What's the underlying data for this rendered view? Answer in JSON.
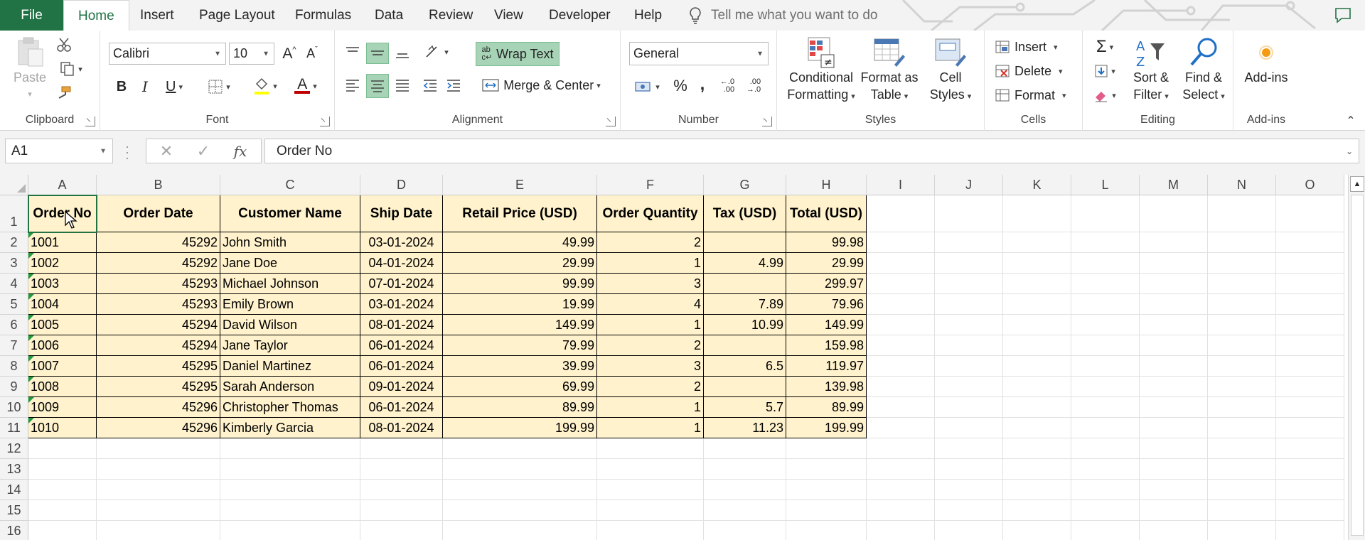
{
  "tabs": {
    "file": "File",
    "items": [
      "Home",
      "Insert",
      "Page Layout",
      "Formulas",
      "Data",
      "Review",
      "View",
      "Developer",
      "Help"
    ],
    "active": "Home",
    "tell_me": "Tell me what you want to do"
  },
  "ribbon": {
    "clipboard": {
      "label": "Clipboard",
      "paste": "Paste"
    },
    "font": {
      "label": "Font",
      "name": "Calibri",
      "size": "10",
      "bold": "B",
      "italic": "I",
      "underline": "U",
      "grow": "A",
      "shrink": "A",
      "fill_letter": "A"
    },
    "alignment": {
      "label": "Alignment",
      "wrap_text": "Wrap Text",
      "merge_center": "Merge & Center"
    },
    "number": {
      "label": "Number",
      "format": "General",
      "percent": "%",
      "comma": ","
    },
    "styles": {
      "label": "Styles",
      "conditional": [
        "Conditional",
        "Formatting"
      ],
      "format_table": [
        "Format as",
        "Table"
      ],
      "cell_styles": [
        "Cell",
        "Styles"
      ]
    },
    "cells": {
      "label": "Cells",
      "insert": "Insert",
      "delete": "Delete",
      "format": "Format"
    },
    "editing": {
      "label": "Editing",
      "sort": [
        "Sort &",
        "Filter"
      ],
      "find": [
        "Find &",
        "Select"
      ]
    },
    "addins": {
      "label": "Add-ins",
      "addins": "Add-ins"
    }
  },
  "formula_bar": {
    "name_box": "A1",
    "fx": "fx",
    "value": "Order No"
  },
  "sheet": {
    "columns": [
      "A",
      "B",
      "C",
      "D",
      "E",
      "F",
      "G",
      "H",
      "I",
      "J",
      "K",
      "L",
      "M",
      "N",
      "O"
    ],
    "rows": [
      "1",
      "2",
      "3",
      "4",
      "5",
      "6",
      "7",
      "8",
      "9",
      "10",
      "11",
      "12",
      "13",
      "14",
      "15",
      "16"
    ],
    "headers": [
      "Order No",
      "Order Date",
      "Customer Name",
      "Ship Date",
      "Retail Price (USD)",
      "Order Quantity",
      "Tax (USD)",
      "Total (USD)"
    ],
    "records": [
      [
        "1001",
        "45292",
        "John Smith",
        "03-01-2024",
        "49.99",
        "2",
        "",
        "99.98"
      ],
      [
        "1002",
        "45292",
        "Jane Doe",
        "04-01-2024",
        "29.99",
        "1",
        "4.99",
        "29.99"
      ],
      [
        "1003",
        "45293",
        "Michael Johnson",
        "07-01-2024",
        "99.99",
        "3",
        "",
        "299.97"
      ],
      [
        "1004",
        "45293",
        "Emily Brown",
        "03-01-2024",
        "19.99",
        "4",
        "7.89",
        "79.96"
      ],
      [
        "1005",
        "45294",
        "David Wilson",
        "08-01-2024",
        "149.99",
        "1",
        "10.99",
        "149.99"
      ],
      [
        "1006",
        "45294",
        "Jane Taylor",
        "06-01-2024",
        "79.99",
        "2",
        "",
        "159.98"
      ],
      [
        "1007",
        "45295",
        "Daniel Martinez",
        "06-01-2024",
        "39.99",
        "3",
        "6.5",
        "119.97"
      ],
      [
        "1008",
        "45295",
        "Sarah Anderson",
        "09-01-2024",
        "69.99",
        "2",
        "",
        "139.98"
      ],
      [
        "1009",
        "45296",
        "Christopher Thomas",
        "06-01-2024",
        "89.99",
        "1",
        "5.7",
        "89.99"
      ],
      [
        "1010",
        "45296",
        "Kimberly Garcia",
        "08-01-2024",
        "199.99",
        "1",
        "11.23",
        "199.99"
      ]
    ],
    "table_fill": "#fff2cc",
    "selected_cell": "A1"
  },
  "colors": {
    "accent": "#217346",
    "selected_button": "#a7d3b6",
    "error_triangle": "#1f9c3a"
  }
}
